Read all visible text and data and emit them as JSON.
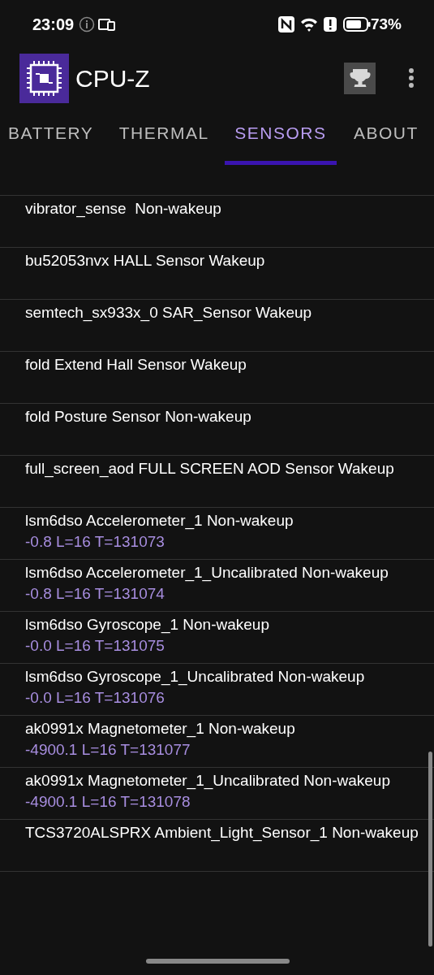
{
  "status_bar": {
    "time": "23:09",
    "battery_text": "73%"
  },
  "app_bar": {
    "title": "CPU-Z"
  },
  "tabs": [
    {
      "label": "BATTERY",
      "selected": false
    },
    {
      "label": "THERMAL",
      "selected": false
    },
    {
      "label": "SENSORS",
      "selected": true
    },
    {
      "label": "ABOUT",
      "selected": false
    }
  ],
  "sensors": [
    {
      "name": "vibrator_sense  Non-wakeup"
    },
    {
      "name": "bu52053nvx HALL Sensor Wakeup"
    },
    {
      "name": "semtech_sx933x_0 SAR_Sensor Wakeup"
    },
    {
      "name": "fold Extend Hall Sensor Wakeup"
    },
    {
      "name": "fold Posture Sensor Non-wakeup"
    },
    {
      "name": "full_screen_aod FULL SCREEN AOD Sensor Wakeup"
    },
    {
      "name": "lsm6dso Accelerometer_1 Non-wakeup",
      "value": "-0.8 L=16 T=131073"
    },
    {
      "name": "lsm6dso Accelerometer_1_Uncalibrated Non-wakeup",
      "value": "-0.8 L=16 T=131074"
    },
    {
      "name": "lsm6dso Gyroscope_1 Non-wakeup",
      "value": "-0.0 L=16 T=131075"
    },
    {
      "name": "lsm6dso Gyroscope_1_Uncalibrated Non-wakeup",
      "value": "-0.0 L=16 T=131076"
    },
    {
      "name": "ak0991x Magnetometer_1 Non-wakeup",
      "value": "-4900.1 L=16 T=131077"
    },
    {
      "name": "ak0991x Magnetometer_1_Uncalibrated Non-wakeup",
      "value": "-4900.1 L=16 T=131078"
    },
    {
      "name": "TCS3720ALSPRX Ambient_Light_Sensor_1 Non-wakeup"
    }
  ]
}
